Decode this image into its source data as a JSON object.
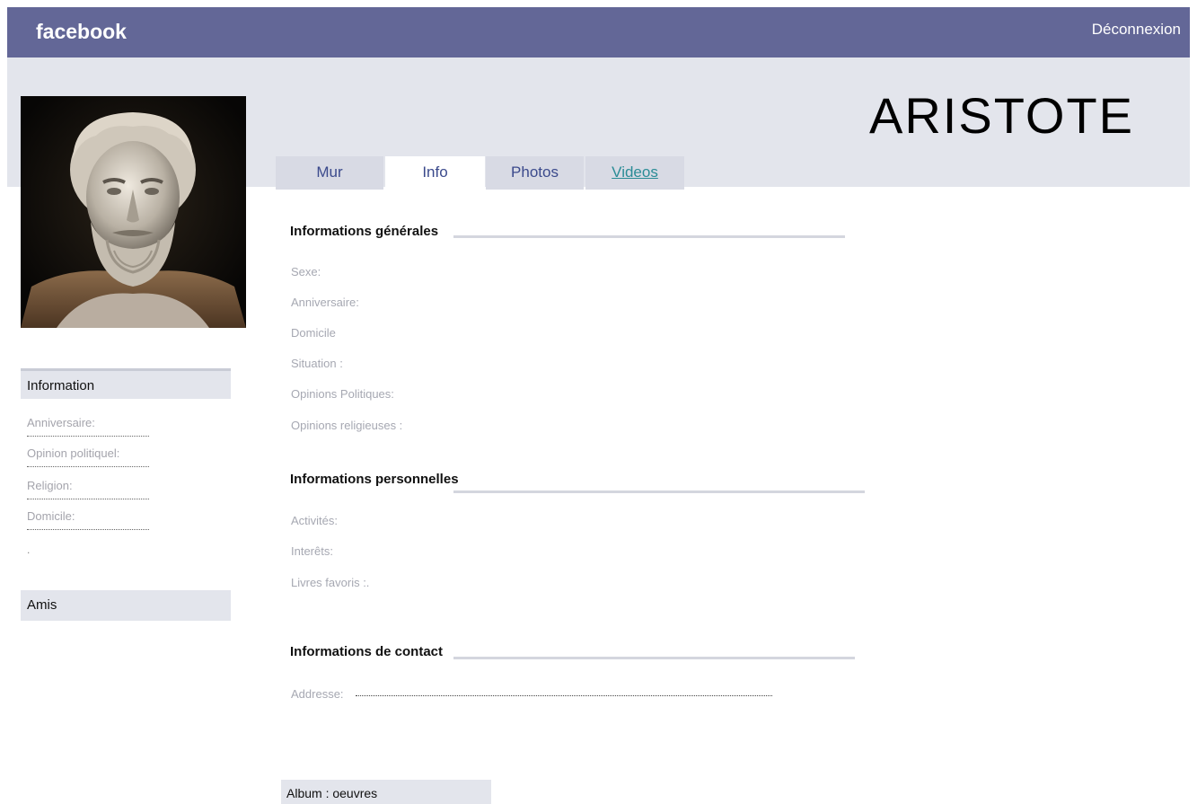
{
  "header": {
    "logo": "facebook",
    "logout": "Déconnexion"
  },
  "profile": {
    "name": "ARISTOTE"
  },
  "tabs": [
    {
      "label": "Mur"
    },
    {
      "label": "Info"
    },
    {
      "label": "Photos"
    },
    {
      "label": "Videos"
    }
  ],
  "sidebar": {
    "info_title": "Information",
    "fields": [
      {
        "label": "Anniversaire:"
      },
      {
        "label": "Opinion politiquel:"
      },
      {
        "label": "Religion:"
      },
      {
        "label": "Domicile:"
      }
    ],
    "trailing": ".",
    "friends_title": "Amis"
  },
  "general": {
    "title": "Informations générales",
    "fields": [
      {
        "label": "Sexe:"
      },
      {
        "label": "Anniversaire:"
      },
      {
        "label": "Domicile"
      },
      {
        "label": "Situation :"
      },
      {
        "label": "Opinions Politiques:"
      },
      {
        "label": "Opinions religieuses :"
      }
    ]
  },
  "personal": {
    "title": "Informations personnelles",
    "fields": [
      {
        "label": "Activités:"
      },
      {
        "label": "Interêts:"
      },
      {
        "label": "Livres favoris :."
      }
    ]
  },
  "contact": {
    "title": "Informations de contact",
    "fields": [
      {
        "label": "Addresse:"
      }
    ]
  },
  "album": {
    "label": "Album : oeuvres"
  }
}
